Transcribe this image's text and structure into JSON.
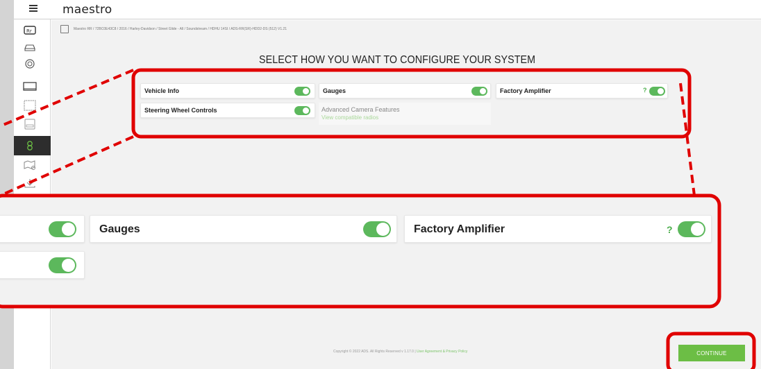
{
  "app": {
    "logo": "maestro"
  },
  "breadcrumb": "Maestro RR / 72BC0E43C8 / 2016 / Harley-Davidson / Street Glide - All / Soundstream / HDHU 14SI / ADS-RR(SR)-HDD2-DS (512) V1.21",
  "title": "SELECT HOW YOU WANT TO CONFIGURE YOUR SYSTEM",
  "options": {
    "vehicle_info": {
      "label": "Vehicle Info",
      "enabled": true
    },
    "gauges": {
      "label": "Gauges",
      "enabled": true
    },
    "factory_amplifier": {
      "label": "Factory Amplifier",
      "help": "?",
      "enabled": true
    },
    "steering_wheel_controls": {
      "label": "Steering Wheel Controls",
      "enabled": true
    },
    "advanced_camera": {
      "label": "Advanced Camera Features",
      "link": "View compatible radios"
    }
  },
  "footer": {
    "copyright": "Copyright © 2022 ADS. All Rights Reserved v 1.17.0 | ",
    "link": "User Agreement & Privacy Policy"
  },
  "actions": {
    "continue": "CONTINUE"
  },
  "colors": {
    "toggle_on": "#5cb85c",
    "accent": "#6cbe45",
    "highlight_red": "#e00000"
  },
  "sidebar_icons": [
    "logo-rr-icon",
    "car-icon",
    "steering-wheel-icon",
    "radio-icon",
    "screen-icon",
    "gauge-icon",
    "settings-icon",
    "map-icon",
    "download-icon"
  ]
}
